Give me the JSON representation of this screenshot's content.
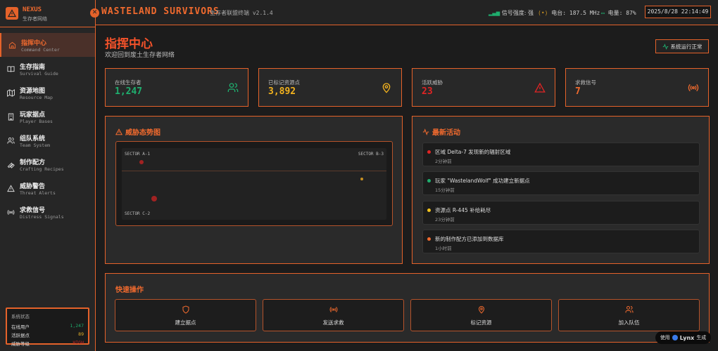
{
  "brand": {
    "name": "NEXUS",
    "subtitle": "生存者网络"
  },
  "sidebar": {
    "items": [
      {
        "label": "指挥中心",
        "sub": "Command Center",
        "icon": "home-icon",
        "active": true
      },
      {
        "label": "生存指南",
        "sub": "Survival Guide",
        "icon": "book-icon"
      },
      {
        "label": "资源地图",
        "sub": "Resource Map",
        "icon": "map-icon"
      },
      {
        "label": "玩家据点",
        "sub": "Player Bases",
        "icon": "building-icon"
      },
      {
        "label": "组队系统",
        "sub": "Team System",
        "icon": "users-icon"
      },
      {
        "label": "制作配方",
        "sub": "Crafting Recipes",
        "icon": "wrench-icon"
      },
      {
        "label": "威胁警告",
        "sub": "Threat Alerts",
        "icon": "alert-icon"
      },
      {
        "label": "求救信号",
        "sub": "Distress Signals",
        "icon": "radio-icon"
      }
    ],
    "status": {
      "title": "系统状态",
      "rows": [
        {
          "label": "在线用户",
          "value": "1,247",
          "color": "#1fae6e"
        },
        {
          "label": "活跃据点",
          "value": "89",
          "color": "#e8b428"
        },
        {
          "label": "威胁等级",
          "value": "HIGH",
          "color": "#c62828"
        }
      ]
    }
  },
  "header": {
    "title": "WASTELAND SURVIVORS",
    "subtitle": "生存者联盟终端 v2.1.4",
    "signal": "信号强度: 强",
    "radio": "电台: 187.5 MHz",
    "battery": "电量: 87%",
    "datetime": "2025/8/28 22:14:49"
  },
  "page": {
    "title": "指挥中心",
    "subtitle": "欢迎回到废土生存者网络",
    "status_button": "系统运行正常"
  },
  "stats": [
    {
      "label": "在线生存者",
      "value": "1,247",
      "color": "#1fae6e",
      "icon": "users-icon"
    },
    {
      "label": "已标记资源点",
      "value": "3,892",
      "color": "#f2b21e",
      "icon": "map-pin-icon"
    },
    {
      "label": "活跃威胁",
      "value": "23",
      "color": "#e02424",
      "icon": "alert-triangle-icon"
    },
    {
      "label": "求救信号",
      "value": "7",
      "color": "#f06a2e",
      "icon": "radio-icon"
    }
  ],
  "threat_map": {
    "title": "威胁态势图",
    "sectors": [
      "SECTOR A-1",
      "SECTOR B-3",
      "SECTOR C-2"
    ]
  },
  "activity": {
    "title": "最新活动",
    "items": [
      {
        "text": "区域 Delta-7 发现新的辐射区域",
        "time": "2分钟前",
        "color": "#e02424"
      },
      {
        "text": "玩家 \"WastelandWolf\" 成功建立新据点",
        "time": "15分钟前",
        "color": "#1fae6e"
      },
      {
        "text": "资源点 R-445 补给耗尽",
        "time": "23分钟前",
        "color": "#f2c31e"
      },
      {
        "text": "新的制作配方已添加到数据库",
        "time": "1小时前",
        "color": "#f06a2e"
      }
    ]
  },
  "quick": {
    "title": "快速操作",
    "buttons": [
      {
        "label": "建立据点",
        "icon": "shield-icon"
      },
      {
        "label": "发送求救",
        "icon": "radio-icon"
      },
      {
        "label": "标记资源",
        "icon": "map-pin-icon"
      },
      {
        "label": "加入队伍",
        "icon": "users-icon"
      }
    ]
  },
  "badge": {
    "prefix": "使用",
    "brand": "Lynx",
    "suffix": "生成"
  },
  "colors": {
    "accent": "#e5622a"
  }
}
